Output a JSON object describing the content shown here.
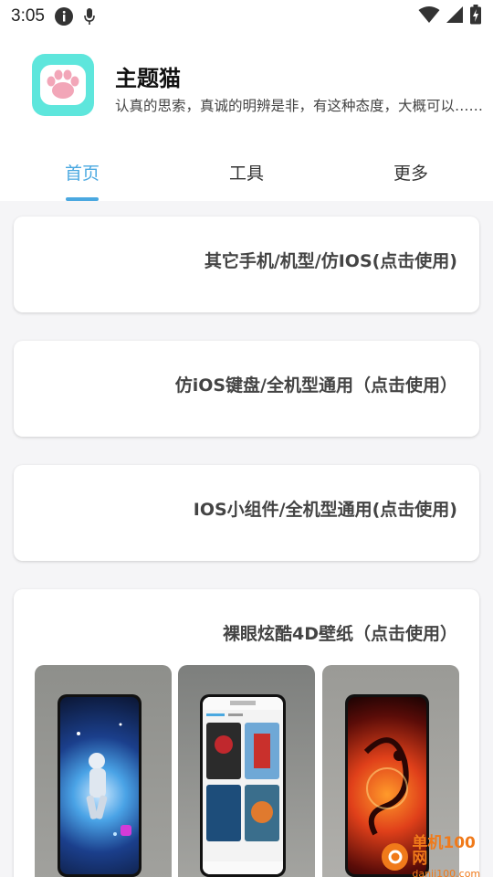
{
  "status_bar": {
    "time": "3:05"
  },
  "app": {
    "name": "主题猫",
    "motto": "认真的思索，真诚的明辨是非，有这种态度，大概可以……",
    "logo_color": "#5ee6dc"
  },
  "tabs": [
    {
      "label": "首页",
      "active": true
    },
    {
      "label": "工具",
      "active": false
    },
    {
      "label": "更多",
      "active": false
    }
  ],
  "accent_color": "#4aa8e0",
  "cards": [
    {
      "label": "其它手机/机型/仿IOS(点击使用)"
    },
    {
      "label": "仿iOS键盘/全机型通用（点击使用）"
    },
    {
      "label": "IOS小组件/全机型通用(点击使用)"
    },
    {
      "label": "裸眼炫酷4D壁纸（点击使用）"
    }
  ],
  "wallpaper_thumbnails": [
    "astronaut-wallpaper",
    "wallpaper-app-screen",
    "dragon-wallpaper"
  ],
  "watermark": {
    "main": "单机100网",
    "sub": "danji100.com"
  }
}
